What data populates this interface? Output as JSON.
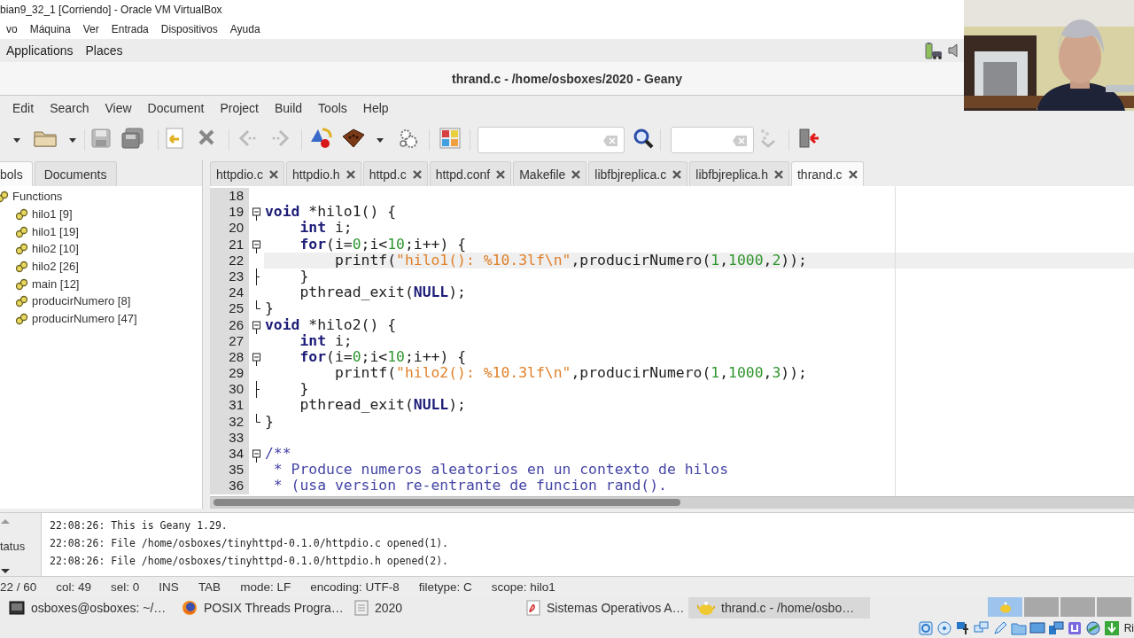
{
  "vm_window": {
    "title": "bian9_32_1 [Corriendo] - Oracle VM VirtualBox"
  },
  "vm_menu": [
    "vo",
    "Máquina",
    "Ver",
    "Entrada",
    "Dispositivos",
    "Ayuda"
  ],
  "desktop_bar": {
    "items": [
      "Applications",
      "Places"
    ]
  },
  "window": {
    "title": "thrand.c - /home/osboxes/2020 - Geany"
  },
  "menu": [
    "Edit",
    "Search",
    "View",
    "Document",
    "Project",
    "Build",
    "Tools",
    "Help"
  ],
  "sidebar": {
    "tabs": [
      {
        "label": "bols",
        "selected": true
      },
      {
        "label": "Documents",
        "selected": false
      }
    ],
    "group": "Functions",
    "items": [
      "hilo1 [9]",
      "hilo1 [19]",
      "hilo2 [10]",
      "hilo2 [26]",
      "main [12]",
      "producirNumero [8]",
      "producirNumero [47]"
    ]
  },
  "tabs": [
    {
      "label": "httpdio.c",
      "selected": false
    },
    {
      "label": "httpdio.h",
      "selected": false
    },
    {
      "label": "httpd.c",
      "selected": false
    },
    {
      "label": "httpd.conf",
      "selected": false
    },
    {
      "label": "Makefile",
      "selected": false
    },
    {
      "label": "libfbjreplica.c",
      "selected": false
    },
    {
      "label": "libfbjreplica.h",
      "selected": false
    },
    {
      "label": "thrand.c",
      "selected": true
    }
  ],
  "editor": {
    "lines": [
      {
        "number": "18",
        "kind": "plain",
        "current": false
      },
      {
        "number": "19",
        "kind": "start",
        "current": false,
        "tokens": [
          {
            "kind": "keyword",
            "text": "void"
          },
          {
            "kind": "plain",
            "text": " *hilo1() {"
          }
        ]
      },
      {
        "number": "20",
        "kind": "body",
        "current": false,
        "tokens": [
          {
            "kind": "keyword",
            "text": "    int"
          },
          {
            "kind": "plain",
            "text": " i;"
          }
        ]
      },
      {
        "number": "21",
        "kind": "start",
        "current": false,
        "tokens": [
          {
            "kind": "keyword",
            "text": "    for"
          },
          {
            "kind": "plain",
            "text": "(i="
          },
          {
            "kind": "number",
            "text": "0"
          },
          {
            "kind": "plain",
            "text": ";i<"
          },
          {
            "kind": "number",
            "text": "10"
          },
          {
            "kind": "plain",
            "text": ";i++) {"
          }
        ]
      },
      {
        "number": "22",
        "kind": "body",
        "current": true,
        "tokens": [
          {
            "kind": "plain",
            "text": "        printf("
          },
          {
            "kind": "string",
            "text": "\"hilo1(): %10.3lf\\n\""
          },
          {
            "kind": "plain",
            "text": ",producirNumero("
          },
          {
            "kind": "number",
            "text": "1"
          },
          {
            "kind": "plain",
            "text": ","
          },
          {
            "kind": "number",
            "text": "1000"
          },
          {
            "kind": "plain",
            "text": ","
          },
          {
            "kind": "number",
            "text": "2"
          },
          {
            "kind": "plain",
            "text": "));"
          }
        ]
      },
      {
        "number": "23",
        "kind": "tick",
        "current": false,
        "tokens": [
          {
            "kind": "plain",
            "text": "    }"
          }
        ]
      },
      {
        "number": "24",
        "kind": "body",
        "current": false,
        "tokens": [
          {
            "kind": "plain",
            "text": "    pthread_exit("
          },
          {
            "kind": "keyword",
            "text": "NULL"
          },
          {
            "kind": "plain",
            "text": ");"
          }
        ]
      },
      {
        "number": "25",
        "kind": "end",
        "current": false,
        "tokens": [
          {
            "kind": "plain",
            "text": "}"
          }
        ]
      },
      {
        "number": "26",
        "kind": "start",
        "current": false,
        "tokens": [
          {
            "kind": "keyword",
            "text": "void"
          },
          {
            "kind": "plain",
            "text": " *hilo2() {"
          }
        ]
      },
      {
        "number": "27",
        "kind": "body",
        "current": false,
        "tokens": [
          {
            "kind": "keyword",
            "text": "    int"
          },
          {
            "kind": "plain",
            "text": " i;"
          }
        ]
      },
      {
        "number": "28",
        "kind": "start",
        "current": false,
        "tokens": [
          {
            "kind": "keyword",
            "text": "    for"
          },
          {
            "kind": "plain",
            "text": "(i="
          },
          {
            "kind": "number",
            "text": "0"
          },
          {
            "kind": "plain",
            "text": ";i<"
          },
          {
            "kind": "number",
            "text": "10"
          },
          {
            "kind": "plain",
            "text": ";i++) {"
          }
        ]
      },
      {
        "number": "29",
        "kind": "body",
        "current": false,
        "tokens": [
          {
            "kind": "plain",
            "text": "        printf("
          },
          {
            "kind": "string",
            "text": "\"hilo2(): %10.3lf\\n\""
          },
          {
            "kind": "plain",
            "text": ",producirNumero("
          },
          {
            "kind": "number",
            "text": "1"
          },
          {
            "kind": "plain",
            "text": ","
          },
          {
            "kind": "number",
            "text": "1000"
          },
          {
            "kind": "plain",
            "text": ","
          },
          {
            "kind": "number",
            "text": "3"
          },
          {
            "kind": "plain",
            "text": "));"
          }
        ]
      },
      {
        "number": "30",
        "kind": "tick",
        "current": false,
        "tokens": [
          {
            "kind": "plain",
            "text": "    }"
          }
        ]
      },
      {
        "number": "31",
        "kind": "body",
        "current": false,
        "tokens": [
          {
            "kind": "plain",
            "text": "    pthread_exit("
          },
          {
            "kind": "keyword",
            "text": "NULL"
          },
          {
            "kind": "plain",
            "text": ");"
          }
        ]
      },
      {
        "number": "32",
        "kind": "end",
        "current": false,
        "tokens": [
          {
            "kind": "plain",
            "text": "}"
          }
        ]
      },
      {
        "number": "33",
        "kind": "plain",
        "current": false
      },
      {
        "number": "34",
        "kind": "start",
        "current": false,
        "tokens": [
          {
            "kind": "comment",
            "text": "/**"
          }
        ]
      },
      {
        "number": "35",
        "kind": "body",
        "current": false,
        "tokens": [
          {
            "kind": "comment",
            "text": " * Produce numeros aleatorios en un contexto de hilos"
          }
        ]
      },
      {
        "number": "36",
        "kind": "body",
        "current": false,
        "tokens": [
          {
            "kind": "comment",
            "text": " * (usa version re-entrante de funcion rand()."
          }
        ]
      }
    ]
  },
  "messages": {
    "tab": "tatus",
    "lines": [
      "22:08:26: This is Geany 1.29.",
      "22:08:26: File /home/osboxes/tinyhttpd-0.1.0/httpdio.c opened(1).",
      "22:08:26: File /home/osboxes/tinyhttpd-0.1.0/httpdio.h opened(2)."
    ]
  },
  "status_bar": [
    "22 / 60",
    "col: 49",
    "sel: 0",
    "INS",
    "TAB",
    "mode: LF",
    "encoding: UTF-8",
    "filetype: C",
    "scope: hilo1"
  ],
  "taskbar": {
    "items": [
      {
        "label": "osboxes@osboxes: ~/…",
        "kind": "terminal",
        "selected": false
      },
      {
        "label": "POSIX Threads Progra…",
        "kind": "browser",
        "selected": false
      },
      {
        "label": "2020",
        "kind": "files",
        "selected": false
      },
      {
        "label": "Sistemas Operativos A…",
        "kind": "pdf",
        "selected": false
      },
      {
        "label": "thrand.c - /home/osbo…",
        "kind": "geany",
        "selected": true
      }
    ],
    "workspaces": [
      {
        "selected": true
      },
      {
        "selected": false
      },
      {
        "selected": false
      },
      {
        "selected": false
      }
    ]
  },
  "vm_status": {
    "label": "Ri"
  }
}
